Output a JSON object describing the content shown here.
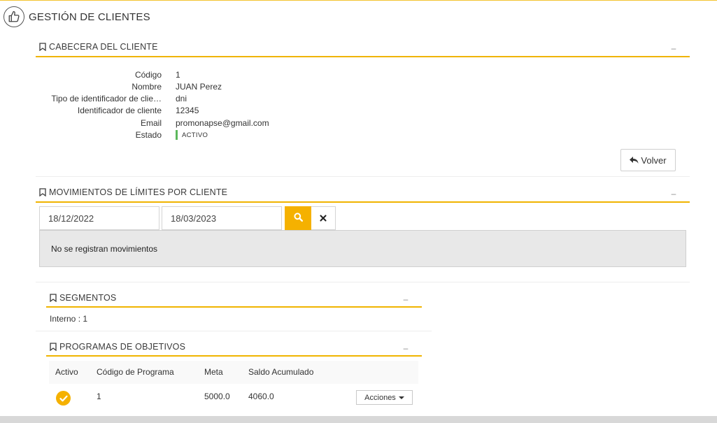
{
  "page": {
    "title": "GESTIÓN DE CLIENTES"
  },
  "header_section": {
    "title": "CABECERA DEL CLIENTE",
    "collapse": "–",
    "fields": [
      {
        "label": "Código",
        "value": "1"
      },
      {
        "label": "Nombre",
        "value": "JUAN Perez"
      },
      {
        "label": "Tipo de identificador de clie…",
        "value": "dni"
      },
      {
        "label": "Identificador de cliente",
        "value": "12345"
      },
      {
        "label": "Email",
        "value": "promonapse@gmail.com"
      },
      {
        "label": "Estado",
        "value": "ACTIVO"
      }
    ],
    "status_color": "#5cb85c",
    "back_button": "Volver"
  },
  "movements": {
    "title": "MOVIMIENTOS DE LÍMITES POR CLIENTE",
    "collapse": "–",
    "date_from": "18/12/2022",
    "date_to": "18/03/2023",
    "empty_message": "No se registran movimientos"
  },
  "segments": {
    "title": "SEGMENTOS",
    "collapse": "–",
    "text": "Interno : 1"
  },
  "programs": {
    "title": "PROGRAMAS DE OBJETIVOS",
    "collapse": "–",
    "columns": [
      "Activo",
      "Código de Programa",
      "Meta",
      "Saldo Acumulado"
    ],
    "rows": [
      {
        "code": "1",
        "meta": "5000.0",
        "saldo": "4060.0",
        "actions": "Acciones"
      }
    ]
  },
  "colors": {
    "accent": "#f0b400",
    "search_button": "#f5b100"
  }
}
